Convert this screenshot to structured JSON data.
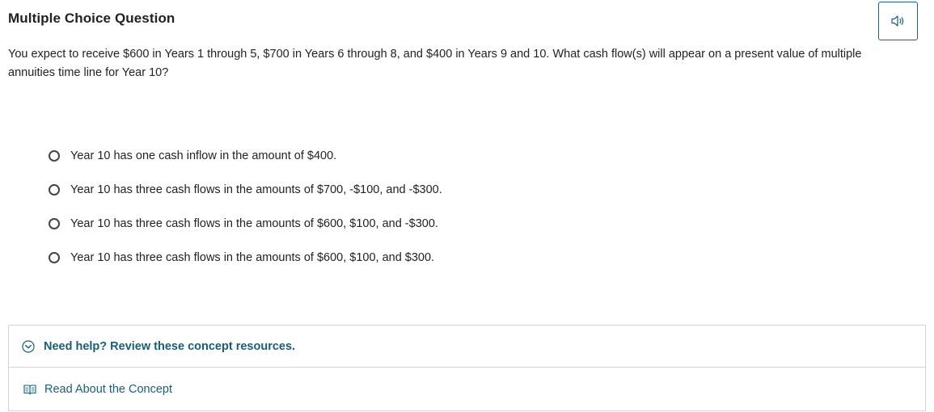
{
  "header": {
    "title": "Multiple Choice Question"
  },
  "question": {
    "text": "You expect to receive $600 in Years 1 through 5, $700 in Years 6 through 8, and $400 in Years 9 and 10. What cash flow(s) will appear on a present value of multiple annuities time line for Year 10?"
  },
  "options": [
    {
      "label": "Year 10 has one cash inflow in the amount of $400."
    },
    {
      "label": "Year 10 has three cash flows in the amounts of $700, -$100, and -$300."
    },
    {
      "label": "Year 10 has three cash flows in the amounts of $600, $100, and -$300."
    },
    {
      "label": "Year 10 has three cash flows in the amounts of $600, $100, and $300."
    }
  ],
  "help": {
    "title": "Need help? Review these concept resources.",
    "link_label": "Read About the Concept"
  },
  "icons": {
    "audio": "speaker-icon",
    "expand": "chevron-down-circle-icon",
    "resource": "book-icon"
  },
  "colors": {
    "accent": "#17607a",
    "text": "#222222",
    "border": "#d4d4d4"
  }
}
